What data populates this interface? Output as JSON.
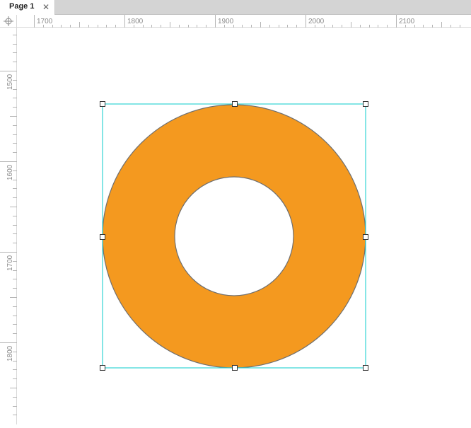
{
  "tabs": [
    {
      "label": "Page 1",
      "close_icon": "close-icon",
      "active": true
    }
  ],
  "ruler_corner_icon": "crosshair-icon",
  "ruler_h": {
    "labels": [
      "1700",
      "1800",
      "1900",
      "2000",
      "2100"
    ]
  },
  "ruler_v": {
    "labels": [
      "1500",
      "1600",
      "1700",
      "1800"
    ]
  },
  "shape": {
    "type": "donut",
    "fill": "#f4991f",
    "stroke": "#6f6f6f",
    "selection_color": "#34d4d4"
  }
}
